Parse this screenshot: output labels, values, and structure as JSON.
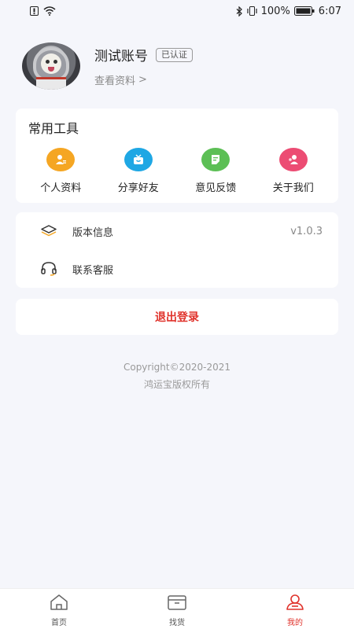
{
  "status_bar": {
    "battery": "100%",
    "time": "6:07"
  },
  "profile": {
    "name": "测试账号",
    "verified": "已认证",
    "view_profile": "查看资料",
    "chevron": ">"
  },
  "tools": {
    "title": "常用工具",
    "items": [
      {
        "label": "个人资料",
        "icon": "user-icon",
        "color": "#f5a623"
      },
      {
        "label": "分享好友",
        "icon": "share-tv-icon",
        "color": "#1ea7e4"
      },
      {
        "label": "意见反馈",
        "icon": "feedback-icon",
        "color": "#5cbf55"
      },
      {
        "label": "关于我们",
        "icon": "about-icon",
        "color": "#ec4c73"
      }
    ]
  },
  "settings": {
    "version_label": "版本信息",
    "version_value": "v1.0.3",
    "support_label": "联系客服"
  },
  "logout": {
    "label": "退出登录"
  },
  "footer": {
    "copyright": "Copyright©2020-2021",
    "rights": "鸿运宝版权所有"
  },
  "tabs": [
    {
      "label": "首页",
      "icon": "home-icon"
    },
    {
      "label": "找货",
      "icon": "box-icon"
    },
    {
      "label": "我的",
      "icon": "profile-icon",
      "active": true
    }
  ],
  "colors": {
    "accent": "#e0322b",
    "background": "#f5f6fb"
  }
}
